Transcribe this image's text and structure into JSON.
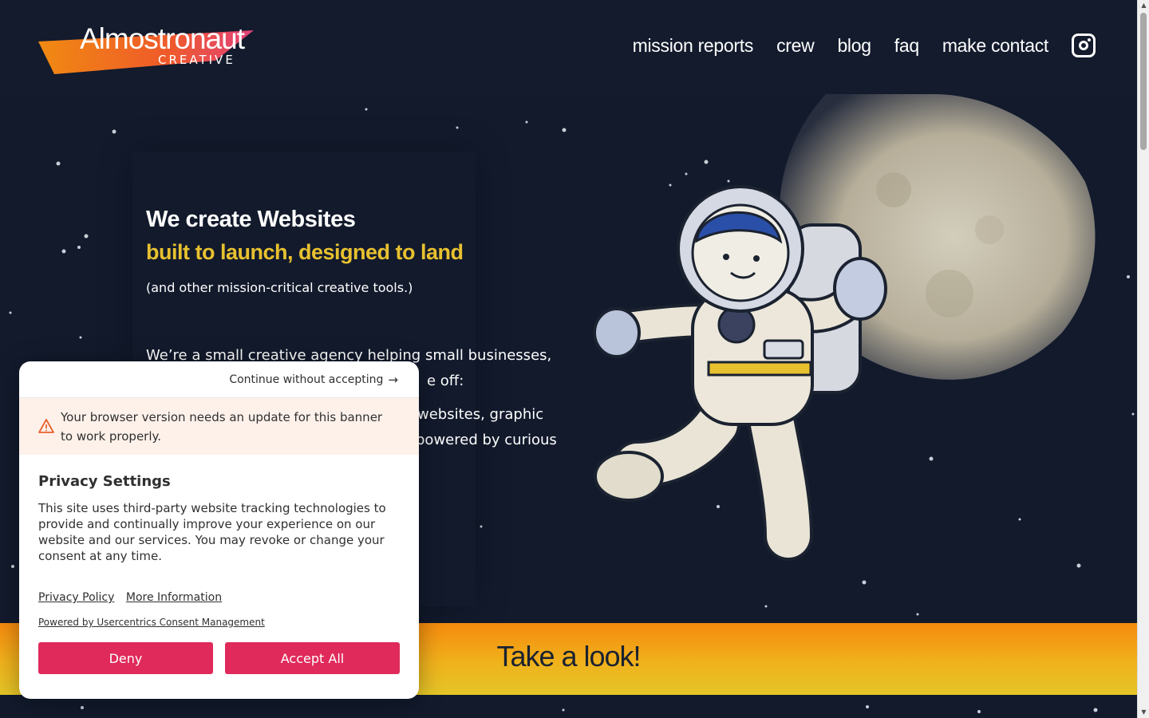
{
  "header": {
    "logo_word": "Almostronaut",
    "logo_sub": "CREATIVE",
    "nav": [
      {
        "label": "mission reports"
      },
      {
        "label": "crew"
      },
      {
        "label": "blog"
      },
      {
        "label": "faq"
      },
      {
        "label": "make contact"
      }
    ],
    "instagram_icon": "instagram-icon"
  },
  "hero": {
    "title": "We create Websites",
    "subtitle": "built to launch, designed to land",
    "small": "(and other mission-critical creative tools.)",
    "p1": "We’re a small creative agency helping small businesses,",
    "p1_tail": "e off:",
    "p2_a": "websites, graphic",
    "p2_b": "powered by curious"
  },
  "cta": {
    "label": "Take a look!"
  },
  "consent": {
    "continue_label": "Continue without accepting",
    "warning": "Your browser version needs an update for this banner to work properly.",
    "title": "Privacy Settings",
    "body": "This site uses third-party website tracking technologies to provide and continually improve your experience on our website and our services. You may revoke or change your consent at any time.",
    "privacy_policy": "Privacy Policy",
    "more_info": "More Information",
    "powered_by": "Powered by Usercentrics Consent Management",
    "deny": "Deny",
    "accept": "Accept All"
  },
  "colors": {
    "background": "#121a2c",
    "accent_yellow": "#e8c12f",
    "cta_orange": "#f58a0e",
    "button_red": "#df2a5b"
  }
}
